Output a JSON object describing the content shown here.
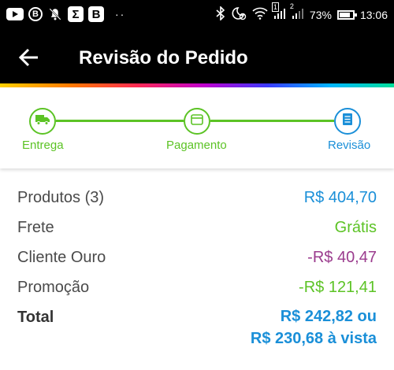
{
  "status_bar": {
    "battery": "73%",
    "time": "13:06",
    "sim1": "1",
    "sim2": "2"
  },
  "appbar": {
    "title": "Revisão do Pedido"
  },
  "steps": [
    {
      "label": "Entrega"
    },
    {
      "label": "Pagamento"
    },
    {
      "label": "Revisão"
    }
  ],
  "summary": {
    "products_label": "Produtos (3)",
    "products_value": "R$ 404,70",
    "shipping_label": "Frete",
    "shipping_value": "Grátis",
    "gold_label": "Cliente Ouro",
    "gold_value": "-R$ 40,47",
    "promo_label": "Promoção",
    "promo_value": "-R$ 121,41",
    "total_label": "Total",
    "total_value_1": "R$ 242,82 ou",
    "total_value_2": "R$ 230,68 à vista"
  },
  "colors": {
    "green": "#5cc325",
    "blue": "#1a8fd8",
    "purple": "#9b3c8e"
  }
}
